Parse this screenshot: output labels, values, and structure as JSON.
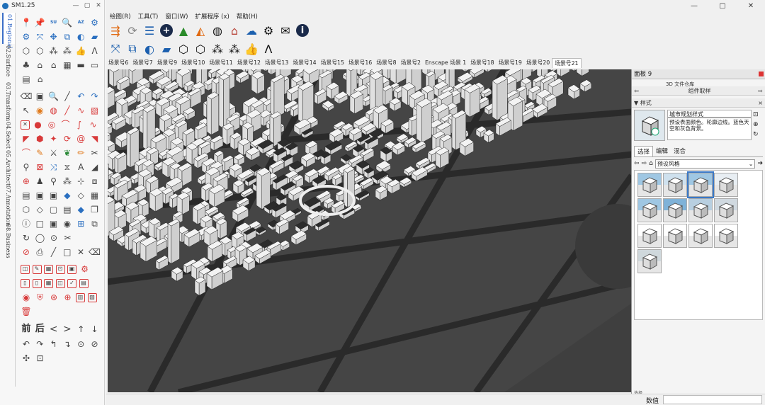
{
  "plugin": {
    "title": "SM1.25",
    "window_controls": [
      "—",
      "▢",
      "✕"
    ],
    "tabs": [
      "01.Regional",
      "02.Surface",
      "03.Transform",
      "04.Select",
      "05.Architect",
      "07.Annotation",
      "08.Business"
    ],
    "active_tab": "01.Regional",
    "nav_labels": [
      "前",
      "后"
    ]
  },
  "app": {
    "window_controls": [
      "—",
      "▢",
      "✕"
    ],
    "menu": [
      "绘图(R)",
      "工具(T)",
      "窗口(W)",
      "扩展程序 (x)",
      "帮助(H)"
    ],
    "scenes": [
      "场景号6",
      "场景号7",
      "场景号9",
      "场景号10",
      "场景号11",
      "场景号12",
      "场景号13",
      "场景号14",
      "场景号15",
      "场景号16",
      "场景号8",
      "场景号2",
      "Enscape 场景 1",
      "场景号18",
      "场景号19",
      "场景号20",
      "场景号21"
    ],
    "active_scene": "场景号21",
    "status_label": "数值",
    "status_value": ""
  },
  "tray": {
    "title": "面板 9",
    "components_label": "组件取样",
    "peek_text": "3D 文件仓库",
    "styles_section": "样式",
    "style_name": "城市规划样式",
    "style_desc": "预设表面颜色。轮廓边线。蓝色天空和灰色背景。",
    "subtabs": [
      "选择",
      "编辑",
      "混合"
    ],
    "active_subtab": "选择",
    "library": "预设风格",
    "bottom_label": "选择"
  },
  "colors": {
    "accent": "#3a79c8",
    "viewport": "#4a4a4a",
    "building": "#f2f2f2",
    "road": "#2b2b2b"
  }
}
